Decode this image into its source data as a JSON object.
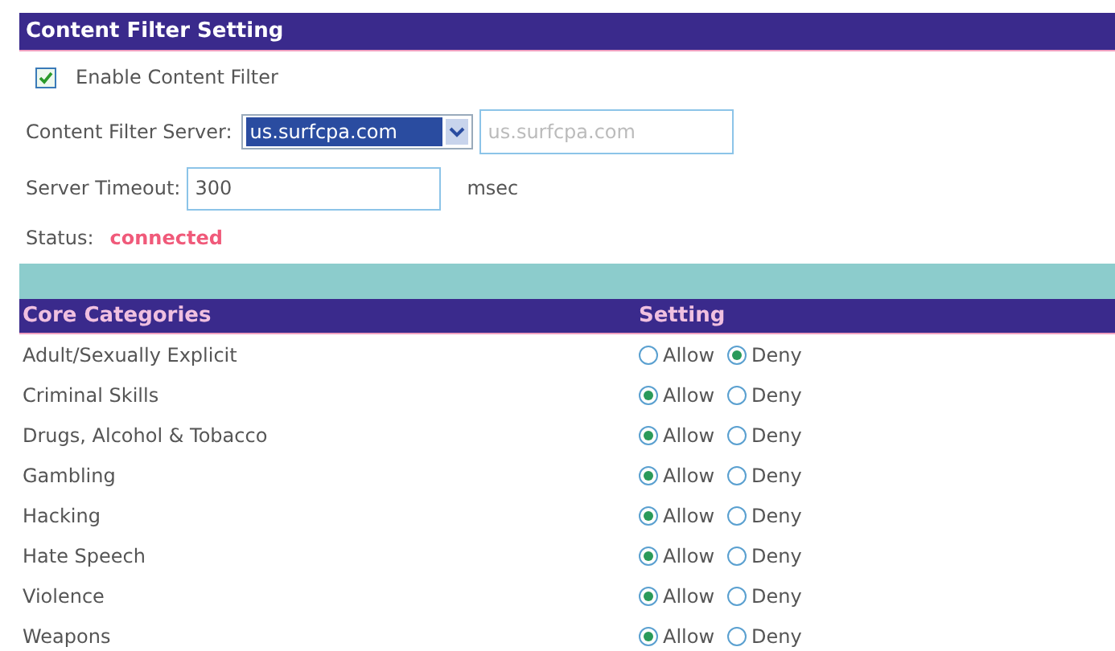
{
  "panel": {
    "title": "Content Filter Setting"
  },
  "enable": {
    "label": "Enable Content Filter",
    "checked": true
  },
  "server": {
    "label": "Content Filter Server:",
    "value": "us.surfcpa.com",
    "text": "us.surfcpa.com"
  },
  "timeout": {
    "label": "Server Timeout:",
    "value": "300",
    "unit": "msec"
  },
  "status": {
    "label": "Status:",
    "value": "connected"
  },
  "table": {
    "columns": [
      "Core Categories",
      "Setting"
    ],
    "rows": [
      {
        "name": "Adult/Sexually Explicit",
        "options": [
          {
            "label": "Allow",
            "selected": false
          },
          {
            "label": "Deny",
            "selected": true
          }
        ]
      },
      {
        "name": "Criminal Skills",
        "options": [
          {
            "label": "Allow",
            "selected": true
          },
          {
            "label": "Deny",
            "selected": false
          }
        ]
      },
      {
        "name": "Drugs, Alcohol & Tobacco",
        "options": [
          {
            "label": "Allow",
            "selected": true
          },
          {
            "label": "Deny",
            "selected": false
          }
        ]
      },
      {
        "name": "Gambling",
        "options": [
          {
            "label": "Allow",
            "selected": true
          },
          {
            "label": "Deny",
            "selected": false
          }
        ]
      },
      {
        "name": "Hacking",
        "options": [
          {
            "label": "Allow",
            "selected": true
          },
          {
            "label": "Deny",
            "selected": false
          }
        ]
      },
      {
        "name": "Hate Speech",
        "options": [
          {
            "label": "Allow",
            "selected": true
          },
          {
            "label": "Deny",
            "selected": false
          }
        ]
      },
      {
        "name": "Violence",
        "options": [
          {
            "label": "Allow",
            "selected": true
          },
          {
            "label": "Deny",
            "selected": false
          }
        ]
      },
      {
        "name": "Weapons",
        "options": [
          {
            "label": "Allow",
            "selected": true
          },
          {
            "label": "Deny",
            "selected": false
          }
        ]
      }
    ]
  }
}
